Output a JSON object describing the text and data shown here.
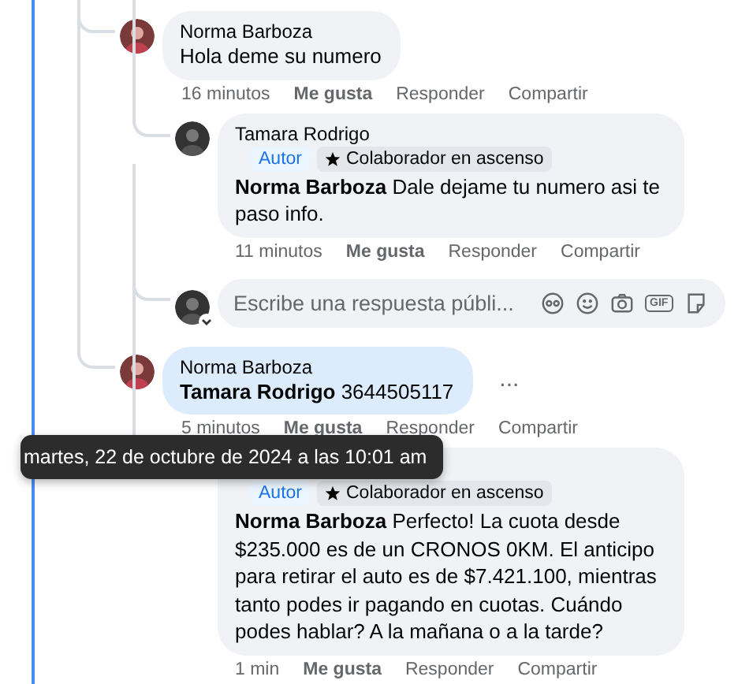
{
  "comments": [
    {
      "author": "Norma Barboza",
      "text": "Hola deme su numero",
      "highlighted": false,
      "time": "16 minutos",
      "time_hovered": false,
      "actions": [
        {
          "label": "Me gusta",
          "emphasis": true
        },
        {
          "label": "Responder",
          "emphasis": false
        },
        {
          "label": "Compartir",
          "emphasis": false
        }
      ],
      "replies": [
        {
          "author": "Tamara Rodrigo",
          "badges": [
            {
              "kind": "author",
              "label": "Autor"
            },
            {
              "kind": "star",
              "label": "Colaborador en ascenso"
            }
          ],
          "text": "**Norma Barboza** Dale dejame tu numero asi te paso info.",
          "time": "11 minutos",
          "time_hovered": false,
          "actions": [
            {
              "label": "Me gusta",
              "emphasis": true
            },
            {
              "label": "Responder",
              "emphasis": false
            },
            {
              "label": "Compartir",
              "emphasis": false
            }
          ]
        }
      ],
      "reply_field": {
        "placeholder": "Escribe una respuesta públi...",
        "gif_label": "GIF"
      }
    },
    {
      "author": "Norma Barboza",
      "text": "**Tamara Rodrigo** 3644505117",
      "highlighted": true,
      "more": "...",
      "time": "5 minutos",
      "time_hovered": true,
      "actions": [
        {
          "label": "Me gusta",
          "emphasis": true
        },
        {
          "label": "Responder",
          "emphasis": false
        },
        {
          "label": "Compartir",
          "emphasis": false
        }
      ],
      "replies": [
        {
          "badges": [
            {
              "kind": "author",
              "label": "Autor"
            },
            {
              "kind": "star",
              "label": "Colaborador en ascenso"
            }
          ],
          "text": "**Norma Barboza** Perfecto! La cuota desde $235.000 es de un CRONOS 0KM. El anticipo para retirar el auto es de $7.421.100, mientras tanto podes ir pagando en cuotas. Cuándo podes hablar? A la mañana o a la tarde?",
          "time": "1 min",
          "time_hovered": false,
          "actions": [
            {
              "label": "Me gusta",
              "emphasis": true
            },
            {
              "label": "Responder",
              "emphasis": false
            },
            {
              "label": "Compartir",
              "emphasis": false
            }
          ]
        }
      ]
    }
  ],
  "tooltip": "martes, 22 de octubre de 2024 a las 10:01 am"
}
